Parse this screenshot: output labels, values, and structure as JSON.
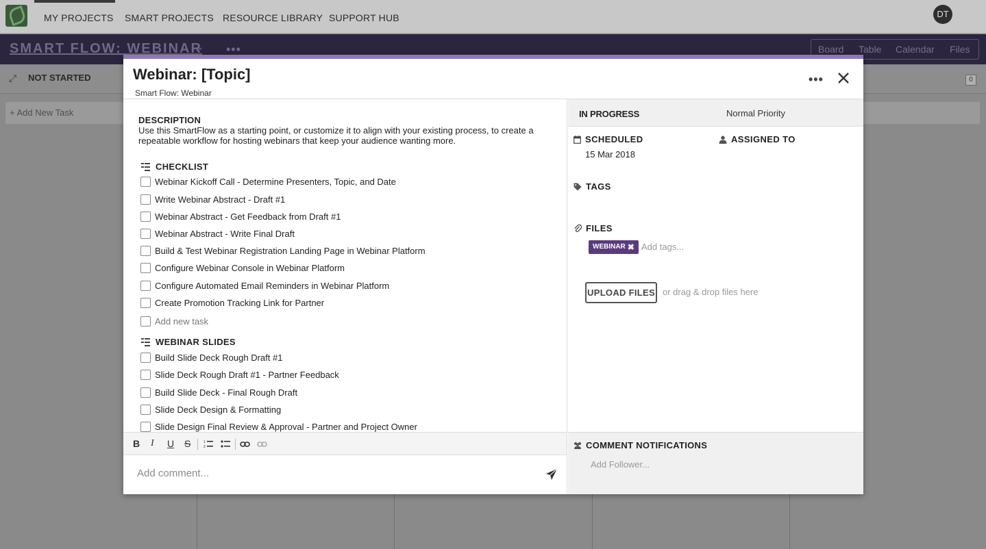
{
  "nav": {
    "items": [
      "MY PROJECTS",
      "SMART PROJECTS",
      "RESOURCE LIBRARY",
      "SUPPORT HUB"
    ],
    "avatar_initials": "DT"
  },
  "project": {
    "title": "SMART FLOW: WEBINAR",
    "view_tabs": [
      "Board",
      "Table",
      "Calendar",
      "Files"
    ],
    "active_view": "Board"
  },
  "board": {
    "column_title": "NOT STARTED",
    "add_task_label": "+ Add New Task",
    "column_count": "0"
  },
  "modal": {
    "title": "Webinar: [Topic]",
    "subtitle": "Smart Flow: Webinar",
    "description_label": "DESCRIPTION",
    "description": "Use this SmartFlow as a starting point, or customize it to align with your existing process, to create a repeatable workflow for hosting webinars that keep your audience wanting more.",
    "checklists": [
      {
        "title": "CHECKLIST",
        "items": [
          "Webinar Kickoff Call - Determine Presenters, Topic, and Date",
          "Write Webinar Abstract - Draft #1",
          "Webinar Abstract - Get Feedback from Draft #1",
          "Webinar Abstract - Write Final Draft",
          "Build & Test Webinar Registration Landing Page in Webinar Platform",
          "Configure Webinar Console in Webinar Platform",
          "Configure Automated Email Reminders in Webinar Platform",
          "Create Promotion Tracking Link for Partner"
        ],
        "add_placeholder": "Add new task"
      },
      {
        "title": "WEBINAR SLIDES",
        "items": [
          "Build Slide Deck Rough Draft #1",
          "Slide Deck Rough Draft #1 - Partner Feedback",
          "Build Slide Deck - Final Rough Draft",
          "Slide Deck Design & Formatting",
          "Slide Design Final Review & Approval - Partner and Project Owner"
        ]
      }
    ],
    "editor_toolbar": [
      "B",
      "I",
      "U",
      "S"
    ],
    "comment_placeholder": "Add comment...",
    "status": "IN PROGRESS",
    "priority": "Normal Priority",
    "scheduled_label": "SCHEDULED",
    "scheduled_date": "15 Mar 2018",
    "assigned_label": "ASSIGNED TO",
    "tags_label": "TAGS",
    "tags": [
      "WEBINAR"
    ],
    "tags_placeholder": "Add tags...",
    "files_label": "FILES",
    "upload_label": "UPLOAD FILES",
    "drop_hint": "or drag & drop files here",
    "notifications_label": "COMMENT NOTIFICATIONS",
    "follower_placeholder": "Add Follower...",
    "tag_color": "#5b3b7e",
    "accent_color": "#8e78b4"
  }
}
